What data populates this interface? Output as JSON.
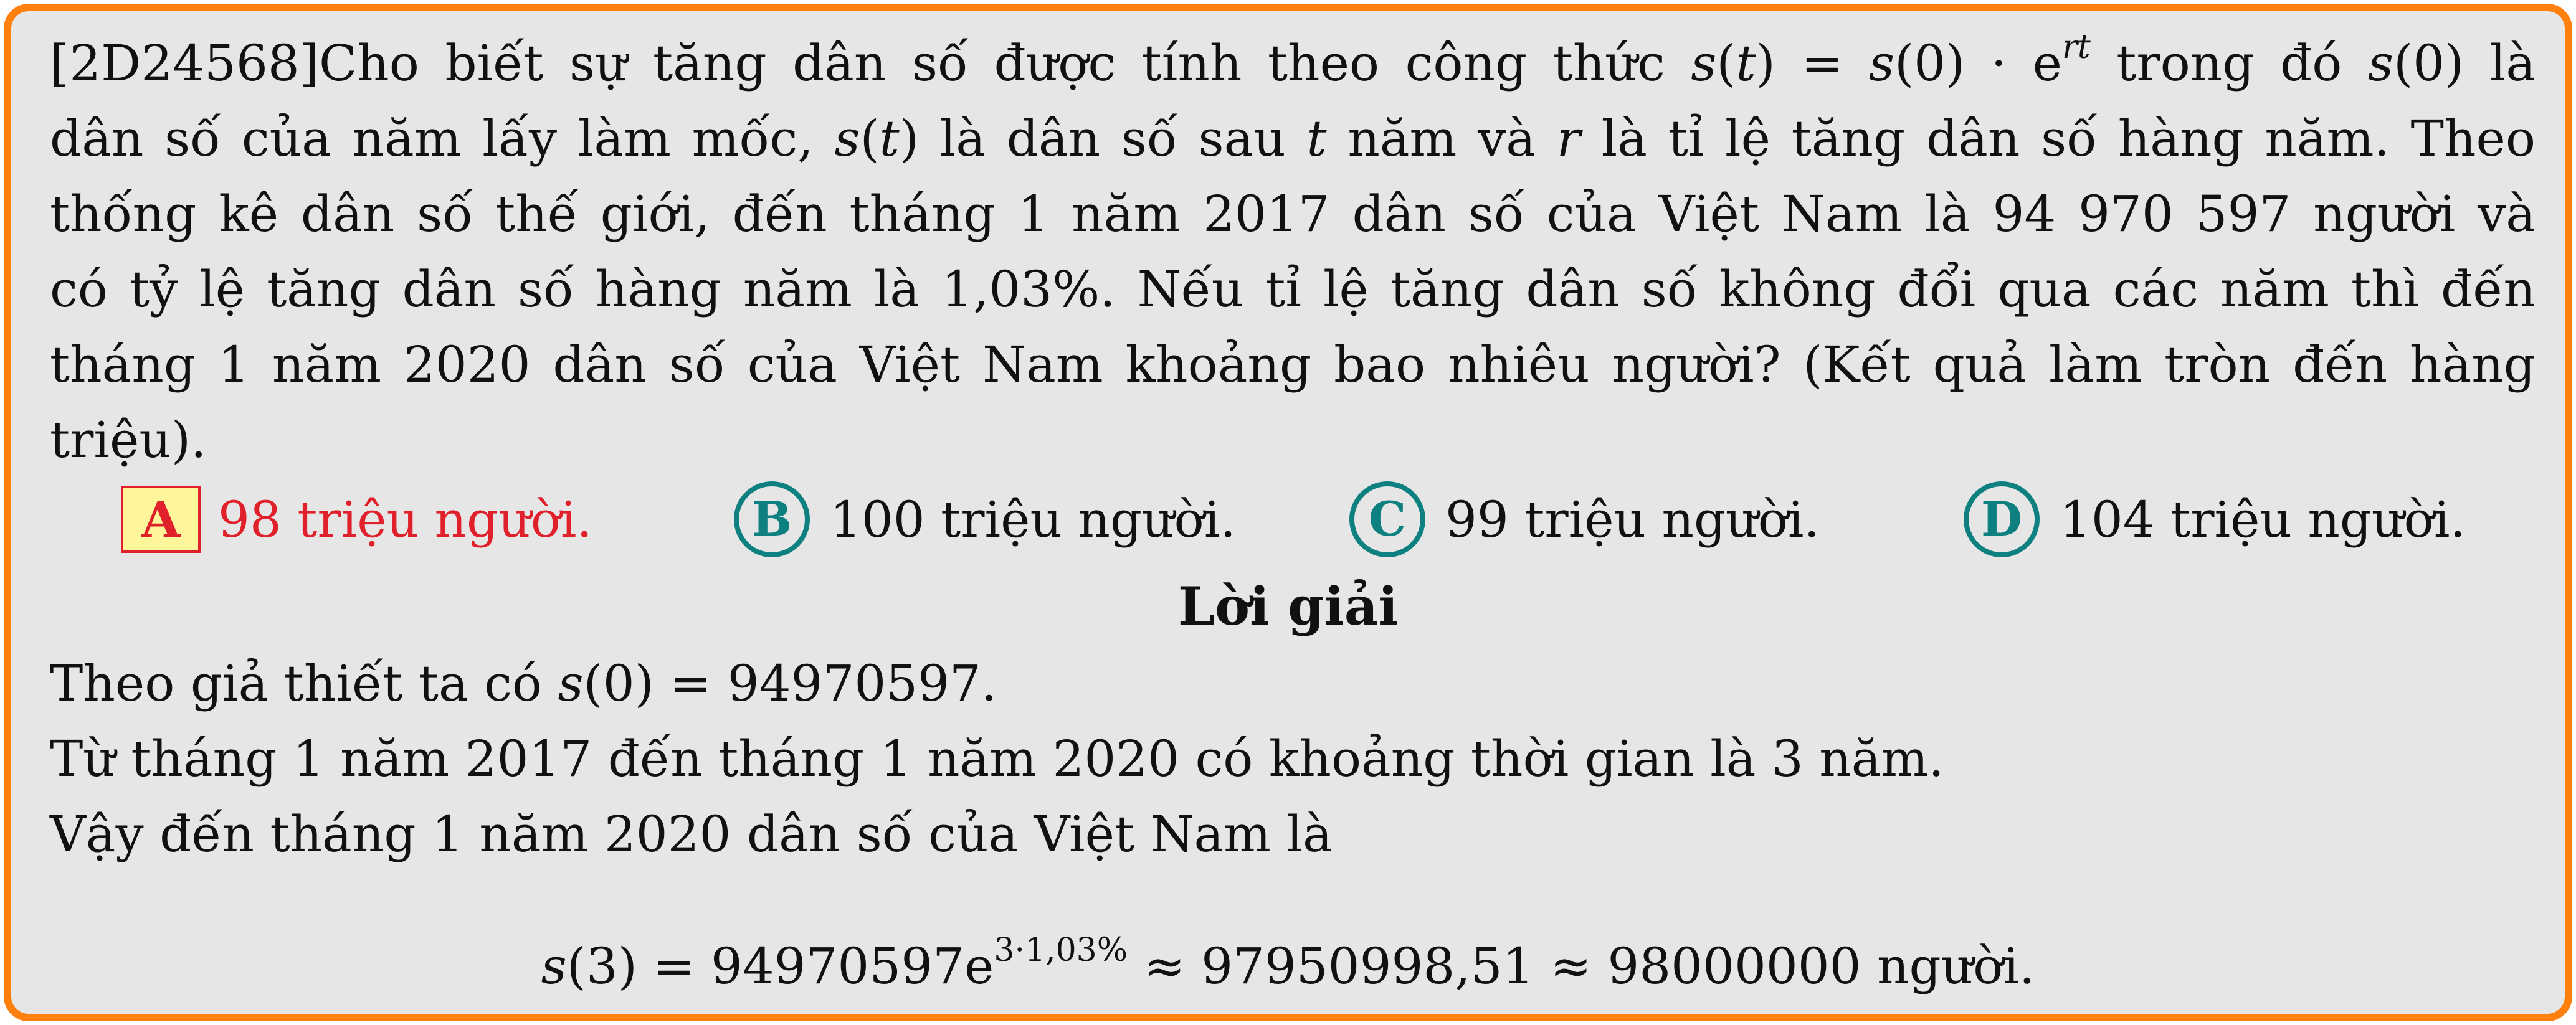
{
  "question": {
    "lines": [
      {
        "id": "q1",
        "segments": [
          {
            "t": "[2D24568]Cho biết sự tăng dân số được tính theo công thức ",
            "m": false
          },
          {
            "t": "s",
            "m": true
          },
          {
            "t": "(",
            "m": false
          },
          {
            "t": "t",
            "m": true
          },
          {
            "t": ") = ",
            "m": false
          },
          {
            "t": "s",
            "m": true
          },
          {
            "t": "(0) · e",
            "m": false
          },
          {
            "t": "rt",
            "m": true,
            "sup": true
          },
          {
            "t": " trong đó ",
            "m": false
          },
          {
            "t": "s",
            "m": true
          },
          {
            "t": "(0) là",
            "m": false
          }
        ]
      },
      {
        "id": "q2",
        "segments": [
          {
            "t": "dân số của năm lấy làm mốc, ",
            "m": false
          },
          {
            "t": "s",
            "m": true
          },
          {
            "t": "(",
            "m": false
          },
          {
            "t": "t",
            "m": true
          },
          {
            "t": ") là dân số sau ",
            "m": false
          },
          {
            "t": "t",
            "m": true
          },
          {
            "t": " năm và ",
            "m": false
          },
          {
            "t": "r",
            "m": true
          },
          {
            "t": " là tỉ lệ tăng dân số hàng năm. Theo",
            "m": false
          }
        ]
      },
      {
        "id": "q3",
        "segments": [
          {
            "t": "thống kê dân số thế giới, đến tháng 1 năm 2017 dân số của Việt Nam là 94 970 597 người và",
            "m": false
          }
        ]
      },
      {
        "id": "q4",
        "segments": [
          {
            "t": "có tỷ lệ tăng dân số hàng năm là 1,03%. Nếu tỉ lệ tăng dân số không đổi qua các năm thì đến",
            "m": false
          }
        ]
      },
      {
        "id": "q5",
        "segments": [
          {
            "t": "tháng 1 năm 2020 dân số của Việt Nam khoảng bao nhiêu người? (Kết quả làm tròn đến hàng",
            "m": false
          }
        ]
      },
      {
        "id": "q6",
        "segments": [
          {
            "t": "triệu).",
            "m": false
          }
        ]
      }
    ]
  },
  "options": [
    {
      "letter": "A",
      "text": "98 triệu người.",
      "correct": true
    },
    {
      "letter": "B",
      "text": "100 triệu người.",
      "correct": false
    },
    {
      "letter": "C",
      "text": "99 triệu người.",
      "correct": false
    },
    {
      "letter": "D",
      "text": "104 triệu người.",
      "correct": false
    }
  ],
  "solution": {
    "heading": "Lời giải",
    "line1_prefix": "Theo giả thiết ta có ",
    "line1_s": "s",
    "line1_rest": "(0) = 94970597.",
    "line2": "Từ tháng 1 năm 2017 đến tháng 1 năm 2020 có khoảng thời gian là 3 năm.",
    "line3": "Vậy đến tháng 1 năm 2020 dân số của Việt Nam là",
    "formula_s": "s",
    "formula_main": "(3) = 94970597e",
    "formula_exp": "3·1,03%",
    "formula_rest": " ≈ 97950998,51 ≈ 98000000 người."
  },
  "colors": {
    "frame": "#ff7f0f",
    "background": "#e6e6e6",
    "correct": "#e0202a",
    "highlight": "#fff59a",
    "option_circle": "#0f8080"
  }
}
